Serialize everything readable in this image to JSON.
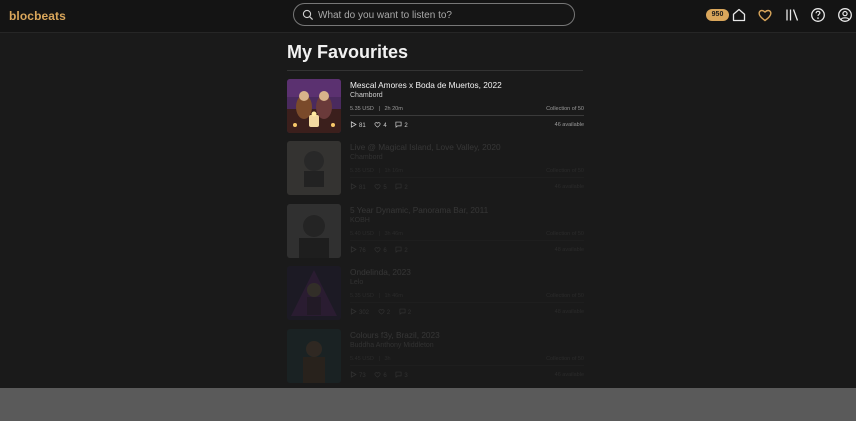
{
  "app": {
    "name": "blocbeats"
  },
  "search": {
    "placeholder": "What do you want to listen to?"
  },
  "header": {
    "credits": "950"
  },
  "icons": [
    "search-icon",
    "home-icon",
    "heart-icon",
    "library-icon",
    "help-icon",
    "account-icon"
  ],
  "colors": {
    "accent": "#d9a65b",
    "background": "#1a1a1a"
  },
  "page": {
    "title": "My Favourites"
  },
  "favourites": [
    {
      "title": "Mescal Amores x Boda de Muertos, 2022",
      "artist": "Chambord",
      "price": "5.35 USD",
      "duration": "2h 20m",
      "collection": "Collection of 50",
      "plays": "81",
      "likes": "4",
      "comments": "2",
      "available": "46 available"
    },
    {
      "title": "Live @ Magical Island, Love Valley, 2020",
      "artist": "Chambord",
      "price": "5.35 USD",
      "duration": "1h 16m",
      "collection": "Collection of 50",
      "plays": "81",
      "likes": "5",
      "comments": "2",
      "available": "46 available"
    },
    {
      "title": "5 Year Dynamic, Panorama Bar, 2011",
      "artist": "KOBH",
      "price": "5.40 USD",
      "duration": "3h 46m",
      "collection": "Collection of 50",
      "plays": "76",
      "likes": "6",
      "comments": "2",
      "available": "48 available"
    },
    {
      "title": "Ondelinda, 2023",
      "artist": "Lelo",
      "price": "5.35 USD",
      "duration": "1h 46m",
      "collection": "Collection of 50",
      "plays": "302",
      "likes": "2",
      "comments": "2",
      "available": "48 available"
    },
    {
      "title": "Colours f3y, Brazil, 2023",
      "artist": "Buddha Anthony Middleton",
      "price": "5.45 USD",
      "duration": "3h",
      "collection": "Collection of 50",
      "plays": "73",
      "likes": "6",
      "comments": "3",
      "available": "46 available"
    }
  ]
}
